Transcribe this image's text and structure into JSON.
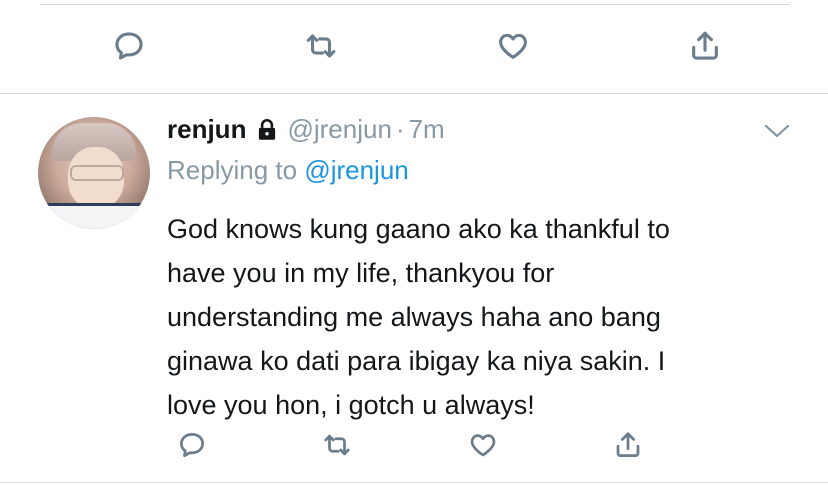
{
  "previous_tweet": {
    "actions": [
      {
        "name": "reply",
        "icon": "reply-icon"
      },
      {
        "name": "retweet",
        "icon": "retweet-icon"
      },
      {
        "name": "like",
        "icon": "heart-icon"
      },
      {
        "name": "share",
        "icon": "share-icon"
      }
    ]
  },
  "tweet": {
    "author_name": "renjun",
    "protected_icon": "lock-icon",
    "handle": "@jrenjun",
    "separator": "·",
    "timestamp": "7m",
    "replying_prefix": "Replying to",
    "replying_to": "@jrenjun",
    "text_lines": [
      "God knows kung gaano ako ka thankful to",
      "have you in my life, thankyou for",
      "understanding me always haha ano bang",
      "ginawa ko dati para ibigay ka niya sakin. I",
      "love you hon, i gotch u always!"
    ],
    "more_icon": "chevron-down-icon",
    "actions": [
      {
        "name": "reply",
        "icon": "reply-icon"
      },
      {
        "name": "retweet",
        "icon": "retweet-icon"
      },
      {
        "name": "like",
        "icon": "heart-icon"
      },
      {
        "name": "share",
        "icon": "share-icon"
      }
    ]
  },
  "colors": {
    "text": "#14171a",
    "secondary": "#8899a6",
    "link": "#1b95e0",
    "icon": "#6b7d8c",
    "divider": "#d9d9d9"
  }
}
